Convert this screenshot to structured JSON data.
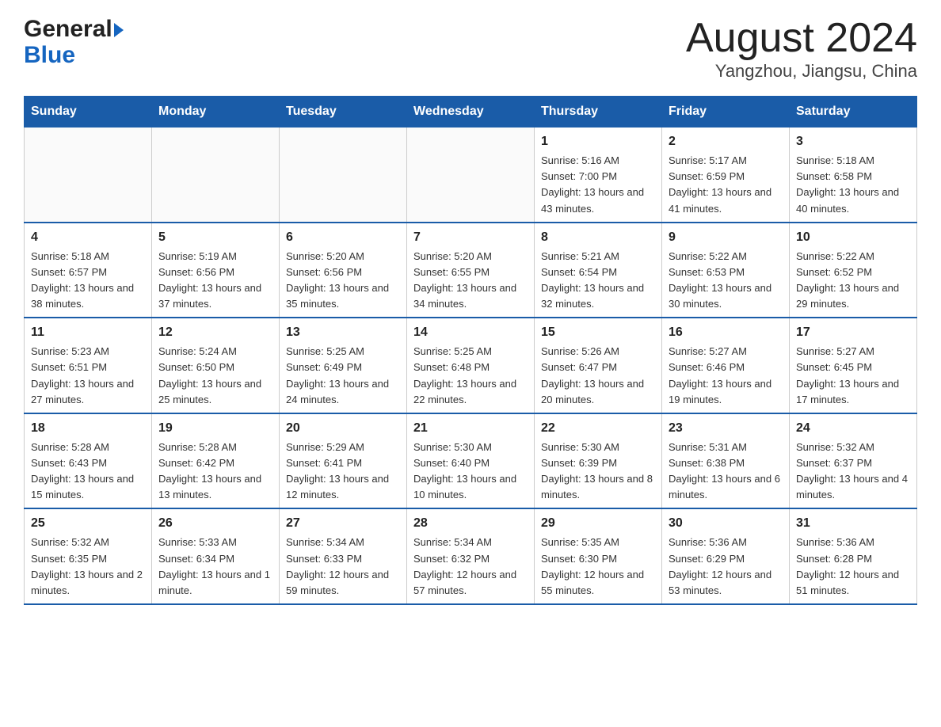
{
  "header": {
    "logo_general": "General",
    "logo_blue": "Blue",
    "title": "August 2024",
    "subtitle": "Yangzhou, Jiangsu, China"
  },
  "days_of_week": [
    "Sunday",
    "Monday",
    "Tuesday",
    "Wednesday",
    "Thursday",
    "Friday",
    "Saturday"
  ],
  "weeks": [
    [
      {
        "num": "",
        "info": ""
      },
      {
        "num": "",
        "info": ""
      },
      {
        "num": "",
        "info": ""
      },
      {
        "num": "",
        "info": ""
      },
      {
        "num": "1",
        "info": "Sunrise: 5:16 AM\nSunset: 7:00 PM\nDaylight: 13 hours\nand 43 minutes."
      },
      {
        "num": "2",
        "info": "Sunrise: 5:17 AM\nSunset: 6:59 PM\nDaylight: 13 hours\nand 41 minutes."
      },
      {
        "num": "3",
        "info": "Sunrise: 5:18 AM\nSunset: 6:58 PM\nDaylight: 13 hours\nand 40 minutes."
      }
    ],
    [
      {
        "num": "4",
        "info": "Sunrise: 5:18 AM\nSunset: 6:57 PM\nDaylight: 13 hours\nand 38 minutes."
      },
      {
        "num": "5",
        "info": "Sunrise: 5:19 AM\nSunset: 6:56 PM\nDaylight: 13 hours\nand 37 minutes."
      },
      {
        "num": "6",
        "info": "Sunrise: 5:20 AM\nSunset: 6:56 PM\nDaylight: 13 hours\nand 35 minutes."
      },
      {
        "num": "7",
        "info": "Sunrise: 5:20 AM\nSunset: 6:55 PM\nDaylight: 13 hours\nand 34 minutes."
      },
      {
        "num": "8",
        "info": "Sunrise: 5:21 AM\nSunset: 6:54 PM\nDaylight: 13 hours\nand 32 minutes."
      },
      {
        "num": "9",
        "info": "Sunrise: 5:22 AM\nSunset: 6:53 PM\nDaylight: 13 hours\nand 30 minutes."
      },
      {
        "num": "10",
        "info": "Sunrise: 5:22 AM\nSunset: 6:52 PM\nDaylight: 13 hours\nand 29 minutes."
      }
    ],
    [
      {
        "num": "11",
        "info": "Sunrise: 5:23 AM\nSunset: 6:51 PM\nDaylight: 13 hours\nand 27 minutes."
      },
      {
        "num": "12",
        "info": "Sunrise: 5:24 AM\nSunset: 6:50 PM\nDaylight: 13 hours\nand 25 minutes."
      },
      {
        "num": "13",
        "info": "Sunrise: 5:25 AM\nSunset: 6:49 PM\nDaylight: 13 hours\nand 24 minutes."
      },
      {
        "num": "14",
        "info": "Sunrise: 5:25 AM\nSunset: 6:48 PM\nDaylight: 13 hours\nand 22 minutes."
      },
      {
        "num": "15",
        "info": "Sunrise: 5:26 AM\nSunset: 6:47 PM\nDaylight: 13 hours\nand 20 minutes."
      },
      {
        "num": "16",
        "info": "Sunrise: 5:27 AM\nSunset: 6:46 PM\nDaylight: 13 hours\nand 19 minutes."
      },
      {
        "num": "17",
        "info": "Sunrise: 5:27 AM\nSunset: 6:45 PM\nDaylight: 13 hours\nand 17 minutes."
      }
    ],
    [
      {
        "num": "18",
        "info": "Sunrise: 5:28 AM\nSunset: 6:43 PM\nDaylight: 13 hours\nand 15 minutes."
      },
      {
        "num": "19",
        "info": "Sunrise: 5:28 AM\nSunset: 6:42 PM\nDaylight: 13 hours\nand 13 minutes."
      },
      {
        "num": "20",
        "info": "Sunrise: 5:29 AM\nSunset: 6:41 PM\nDaylight: 13 hours\nand 12 minutes."
      },
      {
        "num": "21",
        "info": "Sunrise: 5:30 AM\nSunset: 6:40 PM\nDaylight: 13 hours\nand 10 minutes."
      },
      {
        "num": "22",
        "info": "Sunrise: 5:30 AM\nSunset: 6:39 PM\nDaylight: 13 hours\nand 8 minutes."
      },
      {
        "num": "23",
        "info": "Sunrise: 5:31 AM\nSunset: 6:38 PM\nDaylight: 13 hours\nand 6 minutes."
      },
      {
        "num": "24",
        "info": "Sunrise: 5:32 AM\nSunset: 6:37 PM\nDaylight: 13 hours\nand 4 minutes."
      }
    ],
    [
      {
        "num": "25",
        "info": "Sunrise: 5:32 AM\nSunset: 6:35 PM\nDaylight: 13 hours\nand 2 minutes."
      },
      {
        "num": "26",
        "info": "Sunrise: 5:33 AM\nSunset: 6:34 PM\nDaylight: 13 hours\nand 1 minute."
      },
      {
        "num": "27",
        "info": "Sunrise: 5:34 AM\nSunset: 6:33 PM\nDaylight: 12 hours\nand 59 minutes."
      },
      {
        "num": "28",
        "info": "Sunrise: 5:34 AM\nSunset: 6:32 PM\nDaylight: 12 hours\nand 57 minutes."
      },
      {
        "num": "29",
        "info": "Sunrise: 5:35 AM\nSunset: 6:30 PM\nDaylight: 12 hours\nand 55 minutes."
      },
      {
        "num": "30",
        "info": "Sunrise: 5:36 AM\nSunset: 6:29 PM\nDaylight: 12 hours\nand 53 minutes."
      },
      {
        "num": "31",
        "info": "Sunrise: 5:36 AM\nSunset: 6:28 PM\nDaylight: 12 hours\nand 51 minutes."
      }
    ]
  ]
}
